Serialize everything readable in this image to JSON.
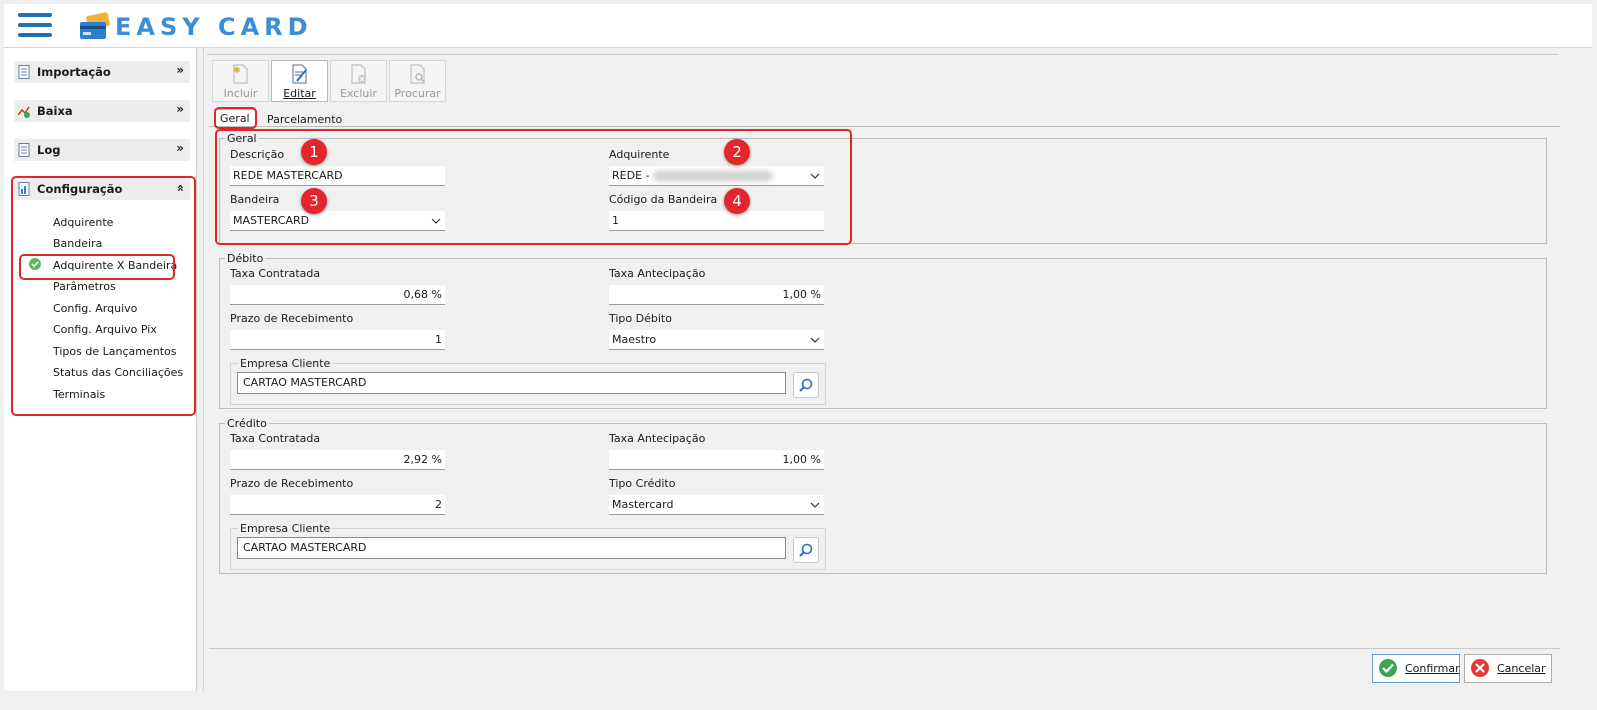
{
  "header": {
    "logo_text": "EASY CARD"
  },
  "sidebar": {
    "menus": [
      {
        "label": "Importação",
        "icon": "document-icon"
      },
      {
        "label": "Baixa",
        "icon": "chart-check-icon"
      },
      {
        "label": "Log",
        "icon": "document-icon"
      },
      {
        "label": "Configuração",
        "icon": "settings-document-icon"
      }
    ],
    "config_items": [
      "Adquirente",
      "Bandeira",
      "Adquirente X Bandeira",
      "Parâmetros",
      "Config. Arquivo",
      "Config. Arquivo Pix",
      "Tipos de Lançamentos",
      "Status das Conciliações",
      "Terminais"
    ],
    "selected_item": "Adquirente X Bandeira"
  },
  "toolbar": {
    "incluir": "Incluir",
    "editar": "Editar",
    "excluir": "Excluir",
    "procurar": "Procurar"
  },
  "tabs": {
    "geral": "Geral",
    "parcelamento": "Parcelamento"
  },
  "geral": {
    "legend": "Geral",
    "descricao_label": "Descrição",
    "descricao_value": "REDE MASTERCARD",
    "adquirente_label": "Adquirente",
    "adquirente_value": "REDE -",
    "bandeira_label": "Bandeira",
    "bandeira_value": "MASTERCARD",
    "codigo_label": "Código da Bandeira",
    "codigo_value": "1"
  },
  "debito": {
    "legend": "Débito",
    "taxa_contratada_label": "Taxa Contratada",
    "taxa_contratada_value": "0,68 %",
    "taxa_antecipacao_label": "Taxa Antecipação",
    "taxa_antecipacao_value": "1,00 %",
    "prazo_label": "Prazo de Recebimento",
    "prazo_value": "1",
    "tipo_label": "Tipo Débito",
    "tipo_value": "Maestro",
    "empresa_label": "Empresa Cliente",
    "empresa_value": "CARTAO MASTERCARD"
  },
  "credito": {
    "legend": "Crédito",
    "taxa_contratada_label": "Taxa Contratada",
    "taxa_contratada_value": "2,92 %",
    "taxa_antecipacao_label": "Taxa Antecipação",
    "taxa_antecipacao_value": "1,00 %",
    "prazo_label": "Prazo de Recebimento",
    "prazo_value": "2",
    "tipo_label": "Tipo Crédito",
    "tipo_value": "Mastercard",
    "empresa_label": "Empresa Cliente",
    "empresa_value": "CARTAO MASTERCARD"
  },
  "badges": [
    "1",
    "2",
    "3",
    "4"
  ],
  "footer": {
    "confirmar": "Confirmar",
    "cancelar": "Cancelar"
  },
  "colors": {
    "accent": "#1d6fb8",
    "annotation_red": "#e0262b",
    "confirm_green": "#3aa655",
    "cancel_red": "#e23a3a"
  }
}
